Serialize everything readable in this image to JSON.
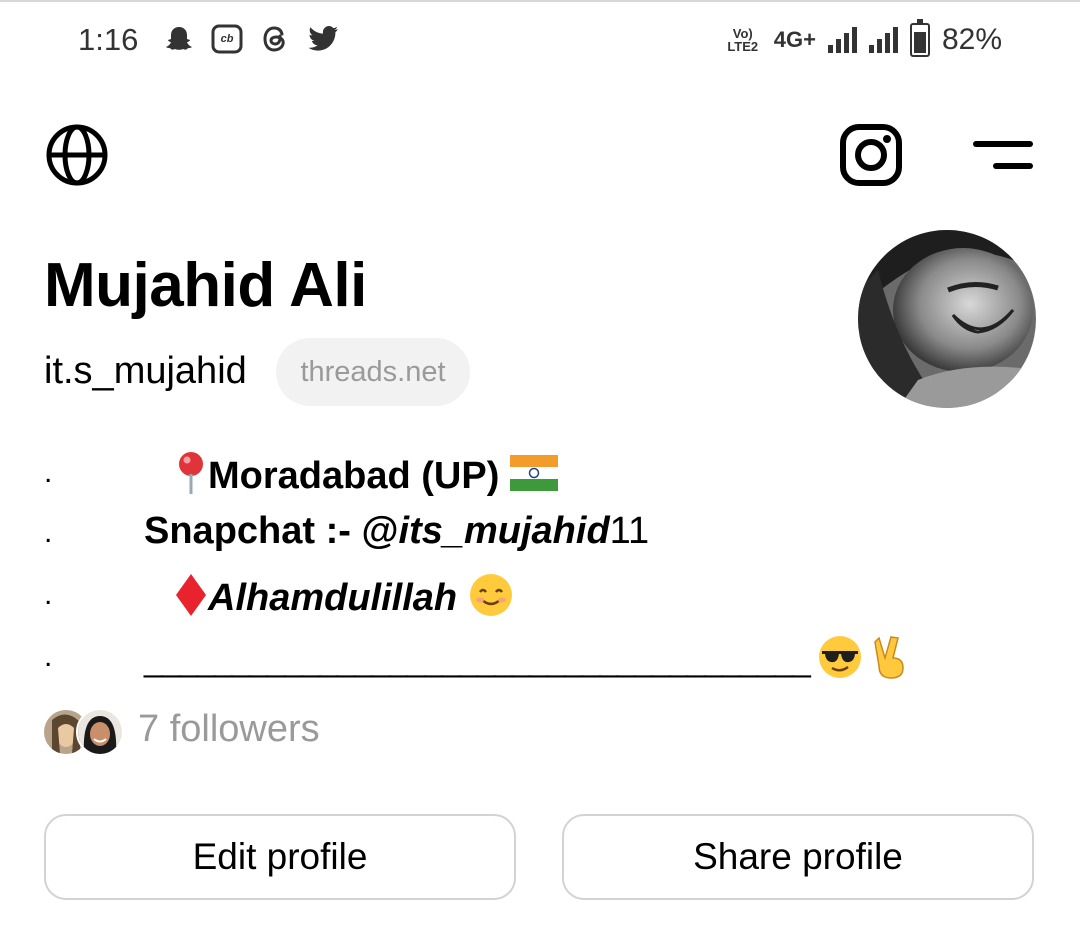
{
  "status_bar": {
    "time": "1:16",
    "icons": [
      "snapchat-icon",
      "cb-icon",
      "threads-icon",
      "twitter-icon"
    ],
    "cb_label": "cb",
    "volte_label": "Vo) LTE2",
    "network": "4G+",
    "battery": "82%",
    "battery_level": 0.82
  },
  "nav": {
    "icons": [
      "globe-icon",
      "instagram-icon",
      "menu-icon"
    ]
  },
  "profile": {
    "name": "Mujahid Ali",
    "username": "it.s_mujahid",
    "domain": "threads.net"
  },
  "bio": {
    "dot": ".",
    "line1": "Moradabad (UP)",
    "line2_label": "Snapchat  :- @",
    "line2_handle": "its_mujahid",
    "line2_suffix": "11",
    "line3": "Alhamdulillah",
    "line4": "______________________________________"
  },
  "followers": {
    "text": "7 followers"
  },
  "buttons": {
    "edit": "Edit profile",
    "share": "Share profile"
  },
  "colors": {
    "muted": "#9a9a9a",
    "pill_bg": "#f2f2f2",
    "border": "#d3d3d3"
  }
}
